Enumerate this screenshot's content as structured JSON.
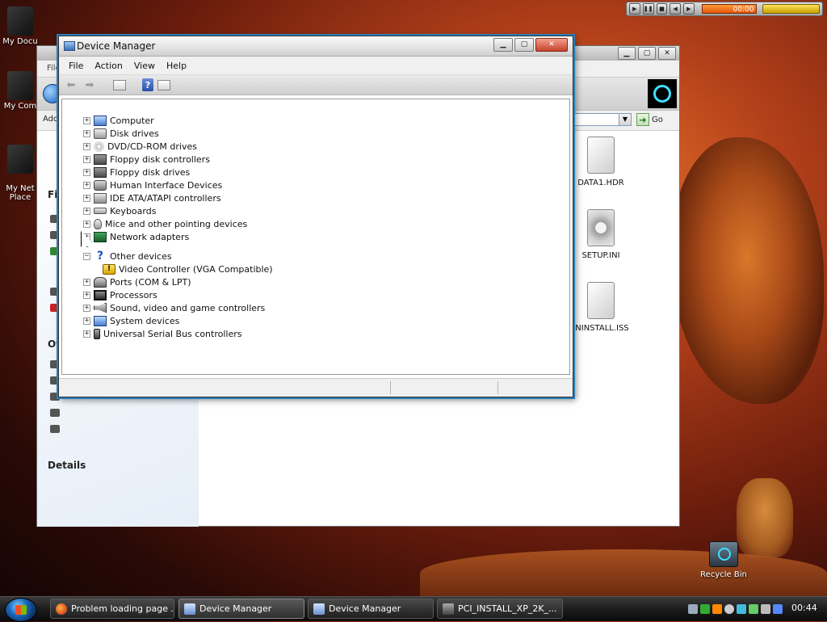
{
  "desktop": {
    "icons": [
      {
        "label": "My Docu"
      },
      {
        "label": "My Com"
      },
      {
        "label": "My Net\nPlace"
      }
    ],
    "recycle_bin": "Recycle Bin"
  },
  "media_player": {
    "time": "00:00"
  },
  "explorer": {
    "menu_partial": "File",
    "address_label": "Add",
    "go_label": "Go",
    "left_pane": {
      "file_tasks": "Fil",
      "other_places": "Ot",
      "details": "Details"
    },
    "files": [
      {
        "name": "DATA1.HDR",
        "icon": "document-icon"
      },
      {
        "name": "SETUP.INI",
        "icon": "settings-file-icon"
      },
      {
        "name": "ININSTALL.ISS",
        "icon": "document-icon"
      }
    ]
  },
  "device_manager": {
    "title": "Device Manager",
    "menu": [
      "File",
      "Action",
      "View",
      "Help"
    ],
    "tree": [
      {
        "label": "Computer",
        "icon": "computer",
        "expander": "+"
      },
      {
        "label": "Disk drives",
        "icon": "disk",
        "expander": "+"
      },
      {
        "label": "DVD/CD-ROM drives",
        "icon": "dvd",
        "expander": "+"
      },
      {
        "label": "Floppy disk controllers",
        "icon": "floppy",
        "expander": "+"
      },
      {
        "label": "Floppy disk drives",
        "icon": "floppy",
        "expander": "+"
      },
      {
        "label": "Human Interface Devices",
        "icon": "hid",
        "expander": "+"
      },
      {
        "label": "IDE ATA/ATAPI controllers",
        "icon": "ide",
        "expander": "+"
      },
      {
        "label": "Keyboards",
        "icon": "keyboard",
        "expander": "+"
      },
      {
        "label": "Mice and other pointing devices",
        "icon": "mouse",
        "expander": "+"
      },
      {
        "label": "Network adapters",
        "icon": "network",
        "expander": "+"
      },
      {
        "label": "Other devices",
        "icon": "unknown",
        "expander": "−"
      },
      {
        "label": "Video Controller (VGA Compatible)",
        "icon": "warning",
        "child": true
      },
      {
        "label": "Ports (COM & LPT)",
        "icon": "port",
        "expander": "+"
      },
      {
        "label": "Processors",
        "icon": "processor",
        "expander": "+"
      },
      {
        "label": "Sound, video and game controllers",
        "icon": "sound",
        "expander": "+"
      },
      {
        "label": "System devices",
        "icon": "system",
        "expander": "+"
      },
      {
        "label": "Universal Serial Bus controllers",
        "icon": "usb",
        "expander": "+"
      }
    ]
  },
  "taskbar": {
    "tasks": [
      {
        "label": "Problem loading page ...",
        "icon": "firefox"
      },
      {
        "label": "Device Manager",
        "icon": "device-manager"
      },
      {
        "label": "Device Manager",
        "icon": "device-manager"
      },
      {
        "label": "PCI_INSTALL_XP_2K_...",
        "icon": "window"
      }
    ],
    "clock": "00:44"
  }
}
